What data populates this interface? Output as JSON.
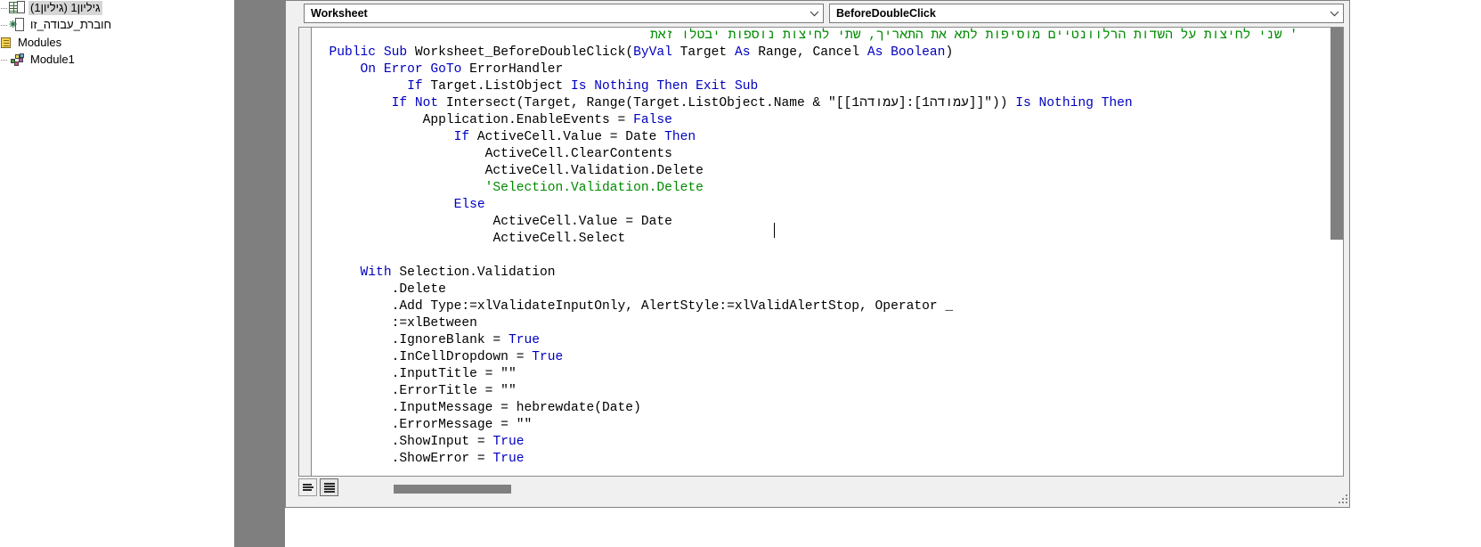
{
  "project_explorer": {
    "items": [
      {
        "label": "גיליון1 (גיליון1)",
        "icon": "worksheet-icon",
        "indent": 16,
        "selected": true
      },
      {
        "label": "חוברת_עבודה_זו",
        "icon": "workbook-icon",
        "indent": 16,
        "selected": false
      },
      {
        "label": "Modules",
        "icon": "modules-folder-icon",
        "indent": 2,
        "selected": false
      },
      {
        "label": "Module1",
        "icon": "module-icon",
        "indent": 16,
        "selected": false
      }
    ]
  },
  "code_window": {
    "object_combo": {
      "value": "Worksheet",
      "icon": "chevron-down-icon"
    },
    "procedure_combo": {
      "value": "BeforeDoubleClick",
      "icon": "chevron-down-icon"
    },
    "bottom_bar": {
      "procedure_view_button": "procedure-view-icon",
      "full_module_view_button": "full-module-view-icon"
    },
    "code_lines": [
      {
        "indent": 4,
        "rtl": true,
        "segments": [
          {
            "t": "' שני לחיצות על השדות הרלוונטיים מוסיפות לתא את התאריך, שתי לחיצות נוספות יבטלו זאת",
            "c": "cmt"
          }
        ]
      },
      {
        "indent": 2,
        "segments": [
          {
            "t": "Public",
            "c": "kw"
          },
          {
            "t": " "
          },
          {
            "t": "Sub",
            "c": "kw"
          },
          {
            "t": " Worksheet_BeforeDoubleClick("
          },
          {
            "t": "ByVal",
            "c": "kw"
          },
          {
            "t": " Target "
          },
          {
            "t": "As",
            "c": "kw"
          },
          {
            "t": " Range, Cancel "
          },
          {
            "t": "As",
            "c": "kw"
          },
          {
            "t": " "
          },
          {
            "t": "Boolean",
            "c": "kw"
          },
          {
            "t": ")"
          }
        ]
      },
      {
        "indent": 6,
        "segments": [
          {
            "t": "On",
            "c": "kw"
          },
          {
            "t": " "
          },
          {
            "t": "Error",
            "c": "kw"
          },
          {
            "t": " "
          },
          {
            "t": "GoTo",
            "c": "kw"
          },
          {
            "t": " ErrorHandler"
          }
        ]
      },
      {
        "indent": 12,
        "segments": [
          {
            "t": "If",
            "c": "kw"
          },
          {
            "t": " Target.ListObject "
          },
          {
            "t": "Is",
            "c": "kw"
          },
          {
            "t": " "
          },
          {
            "t": "Nothing",
            "c": "kw"
          },
          {
            "t": " "
          },
          {
            "t": "Then",
            "c": "kw"
          },
          {
            "t": " "
          },
          {
            "t": "Exit",
            "c": "kw"
          },
          {
            "t": " "
          },
          {
            "t": "Sub",
            "c": "kw"
          }
        ]
      },
      {
        "indent": 10,
        "segments": [
          {
            "t": "If",
            "c": "kw"
          },
          {
            "t": " "
          },
          {
            "t": "Not",
            "c": "kw"
          },
          {
            "t": " Intersect(Target, Range(Target.ListObject.Name & \"[[עמודה1]:[עמודה1]]\")) "
          },
          {
            "t": "Is",
            "c": "kw"
          },
          {
            "t": " "
          },
          {
            "t": "Nothing",
            "c": "kw"
          },
          {
            "t": " "
          },
          {
            "t": "Then",
            "c": "kw"
          }
        ]
      },
      {
        "indent": 14,
        "segments": [
          {
            "t": "Application.EnableEvents = "
          },
          {
            "t": "False",
            "c": "kw"
          }
        ]
      },
      {
        "indent": 18,
        "segments": [
          {
            "t": "If",
            "c": "kw"
          },
          {
            "t": " ActiveCell.Value = Date "
          },
          {
            "t": "Then",
            "c": "kw"
          }
        ]
      },
      {
        "indent": 22,
        "segments": [
          {
            "t": "ActiveCell.ClearContents"
          }
        ]
      },
      {
        "indent": 22,
        "segments": [
          {
            "t": "ActiveCell.Validation.Delete"
          }
        ]
      },
      {
        "indent": 22,
        "segments": [
          {
            "t": "'Selection.Validation.Delete",
            "c": "cmt"
          }
        ]
      },
      {
        "indent": 18,
        "segments": [
          {
            "t": "Else",
            "c": "kw"
          }
        ]
      },
      {
        "indent": 23,
        "segments": [
          {
            "t": "ActiveCell.Value = Date"
          }
        ]
      },
      {
        "indent": 23,
        "segments": [
          {
            "t": "ActiveCell.Select"
          }
        ]
      },
      {
        "indent": 0,
        "segments": [
          {
            "t": ""
          }
        ]
      },
      {
        "indent": 6,
        "segments": [
          {
            "t": "With",
            "c": "kw"
          },
          {
            "t": " Selection.Validation"
          }
        ]
      },
      {
        "indent": 10,
        "segments": [
          {
            "t": ".Delete"
          }
        ]
      },
      {
        "indent": 10,
        "segments": [
          {
            "t": ".Add Type:=xlValidateInputOnly, AlertStyle:=xlValidAlertStop, Operator _"
          }
        ]
      },
      {
        "indent": 10,
        "segments": [
          {
            "t": ":=xlBetween"
          }
        ]
      },
      {
        "indent": 10,
        "segments": [
          {
            "t": ".IgnoreBlank = "
          },
          {
            "t": "True",
            "c": "kw"
          }
        ]
      },
      {
        "indent": 10,
        "segments": [
          {
            "t": ".InCellDropdown = "
          },
          {
            "t": "True",
            "c": "kw"
          }
        ]
      },
      {
        "indent": 10,
        "segments": [
          {
            "t": ".InputTitle = \"\""
          }
        ]
      },
      {
        "indent": 10,
        "segments": [
          {
            "t": ".ErrorTitle = \"\""
          }
        ]
      },
      {
        "indent": 10,
        "segments": [
          {
            "t": ".InputMessage = hebrewdate(Date)"
          }
        ]
      },
      {
        "indent": 10,
        "segments": [
          {
            "t": ".ErrorMessage = \"\""
          }
        ]
      },
      {
        "indent": 10,
        "segments": [
          {
            "t": ".ShowInput = "
          },
          {
            "t": "True",
            "c": "kw"
          }
        ]
      },
      {
        "indent": 10,
        "segments": [
          {
            "t": ".ShowError = "
          },
          {
            "t": "True",
            "c": "kw"
          }
        ]
      }
    ]
  },
  "colors": {
    "keyword": "#0000c0",
    "comment": "#008a00",
    "code_background": "#ffffff",
    "window_chrome": "#f0f0f0",
    "scrollbar_thumb": "#808080",
    "splitter": "#808080",
    "selection": "#d6d6d6"
  }
}
